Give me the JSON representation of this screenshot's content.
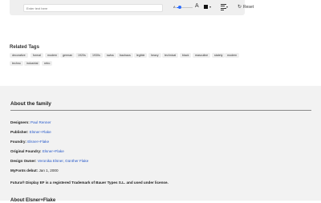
{
  "toolbar": {
    "placeholder": "Enter text here",
    "size_small": "A",
    "size_large": "A",
    "size_level": 0.2,
    "color": "#111111",
    "reset_label": "Reset"
  },
  "tags": {
    "title": "Related Tags",
    "row1": [
      "decorative",
      "formal",
      "modern",
      "german",
      "1920s",
      "1930s",
      "swiss",
      "bauhaus",
      "legible",
      "heavy",
      "technical",
      "black",
      "masculine",
      "stately",
      "modern"
    ],
    "row2": [
      "techno",
      "industrial",
      "retro"
    ]
  },
  "family": {
    "title": "About the family",
    "designers_label": "Designers:",
    "designers_value": "Paul Renner",
    "publisher_label": "Publisher:",
    "publisher_value": "Elsner+Flake",
    "foundry_label": "Foundry:",
    "foundry_value": "Elsner+Flake",
    "original_foundry_label": "Original Foundry:",
    "original_foundry_value": "Elsner+Flake",
    "design_owner_label": "Design Owner:",
    "design_owner_value": "Veronika Elsner, Günther Flake",
    "debut_label": "MyFonts debut:",
    "debut_value": "Jan 1, 2000",
    "trademark": "Futura® Display EF is a registered Trademark of Bauer Types S.L. and used under license.",
    "footer_title": "About Elsner+Flake"
  },
  "colors": {
    "accent": "#2557c8",
    "slider": "#2b6cff",
    "section_bg": "#f2f2f2"
  }
}
